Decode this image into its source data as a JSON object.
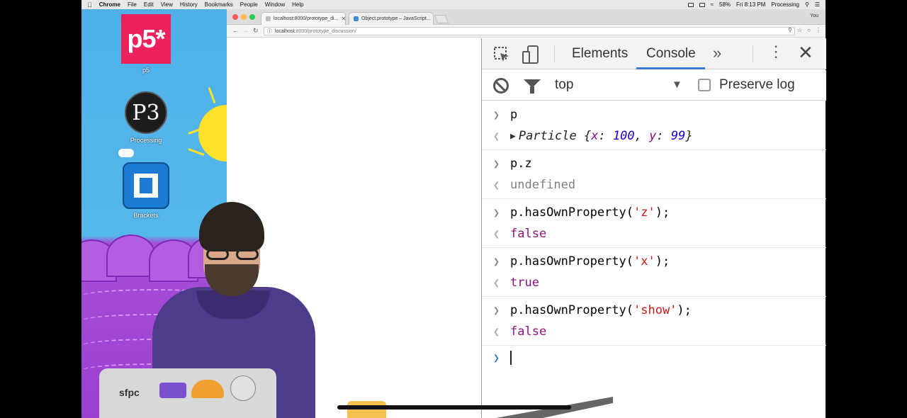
{
  "menubar": {
    "app_name": "Chrome",
    "menus": [
      "File",
      "Edit",
      "View",
      "History",
      "Bookmarks",
      "People",
      "Window",
      "Help"
    ],
    "battery": "58%",
    "clock": "Fri 8:13 PM",
    "active_app": "Processing"
  },
  "desktop": {
    "icons": [
      {
        "label": "p5",
        "logo_text": "p5*"
      },
      {
        "label": "Processing",
        "logo_text": "P3"
      },
      {
        "label": "Brackets"
      }
    ],
    "laptop_sticker_text": "sfpc"
  },
  "browser": {
    "tabs": [
      {
        "title": "localhost:8000/prototype_di..."
      },
      {
        "title": "Object.prototype – JavaScript..."
      }
    ],
    "profile": "You",
    "url_host": "localhost",
    "url_rest": ":8000/prototype_discussion/"
  },
  "devtools": {
    "tabs": {
      "elements": "Elements",
      "console": "Console"
    },
    "context": "top",
    "preserve_log": "Preserve log",
    "preserve_log_checked": false
  },
  "console": {
    "cmd1": "p",
    "out1_class": "Particle",
    "out1_keys": [
      "x",
      "y"
    ],
    "out1_vals": [
      "100",
      "99"
    ],
    "cmd2": "p.z",
    "out2": "undefined",
    "cmd3_prefix": "p.hasOwnProperty(",
    "cmd3_arg": "'z'",
    "cmd3_suffix": ");",
    "out3": "false",
    "cmd4_prefix": "p.hasOwnProperty(",
    "cmd4_arg": "'x'",
    "cmd4_suffix": ");",
    "out4": "true",
    "cmd5_prefix": "p.hasOwnProperty(",
    "cmd5_arg": "'show'",
    "cmd5_suffix": ");",
    "out5": "false"
  },
  "colors": {
    "console_tab_underline": "#3879d9",
    "string": "#c41a16",
    "keyword": "#881280",
    "number": "#1c00cf",
    "p5_brand": "#ed225d",
    "brackets_brand": "#1c7cd5"
  }
}
